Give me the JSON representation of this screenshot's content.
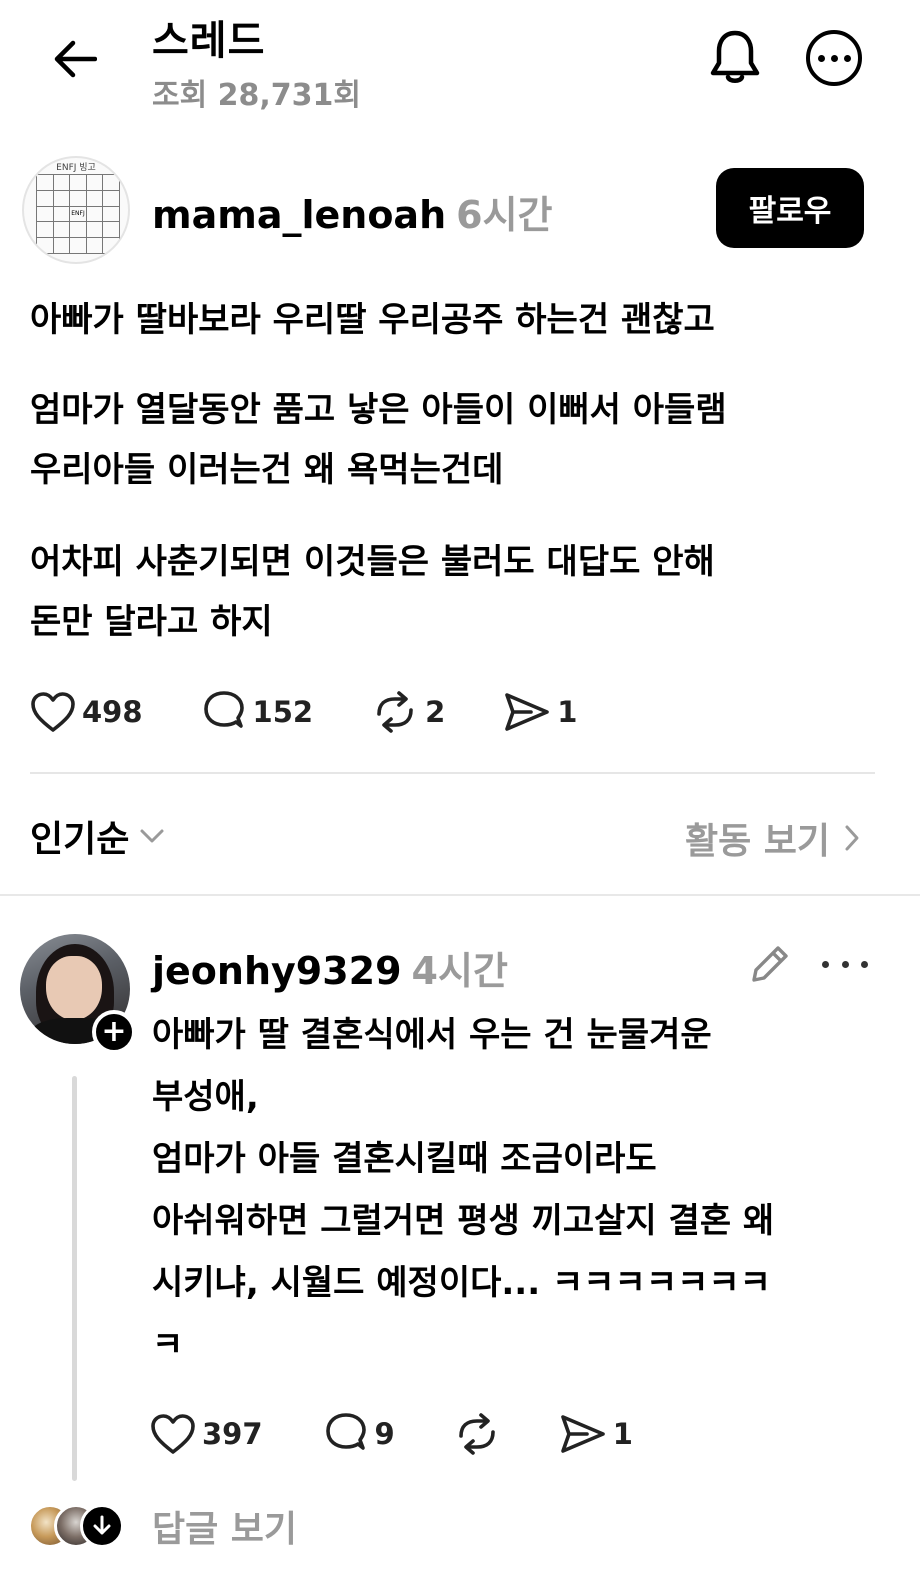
{
  "header": {
    "title": "스레드",
    "views": "조회 28,731회"
  },
  "post": {
    "author": "mama_lenoah",
    "time": "6시간",
    "follow_label": "팔로우",
    "avatar_caption": "ENFJ 빙고",
    "avatar_center": "ENFJ",
    "paragraphs": [
      [
        "아빠가 딸바보라 우리딸 우리공주 하는건 괜찮고"
      ],
      [
        "엄마가 열달동안 품고 낳은 아들이 이뻐서 아들램",
        "우리아들 이러는건 왜 욕먹는건데"
      ],
      [
        "어차피 사춘기되면 이것들은 불러도 대답도 안해",
        "돈만 달라고 하지"
      ]
    ],
    "stats": {
      "likes": "498",
      "comments": "152",
      "reposts": "2",
      "shares": "1"
    }
  },
  "sort": {
    "label": "인기순",
    "activity_label": "활동 보기"
  },
  "comment": {
    "author": "jeonhy9329",
    "time": "4시간",
    "text": "아빠가 딸 결혼식에서 우는 건 눈물겨운\n부성애,\n엄마가 아들 결혼시킬때 조금이라도\n아쉬워하면 그럴거면 평생 끼고살지 결혼 왜\n시키냐, 시월드 예정이다... ㅋㅋㅋㅋㅋㅋㅋ\nㅋ",
    "stats": {
      "likes": "397",
      "comments": "9",
      "shares": "1"
    },
    "view_replies_label": "답글 보기"
  },
  "icons": {
    "back": "arrow-left-icon",
    "notifications": "bell-icon",
    "more": "more-icon",
    "like": "heart-icon",
    "comment": "comment-icon",
    "repost": "repost-icon",
    "share": "send-icon",
    "edit": "pencil-icon",
    "sort": "chevron-down-icon",
    "activity": "chevron-right-icon",
    "add": "plus-icon",
    "expand": "arrow-down-icon"
  },
  "colors": {
    "text": "#000000",
    "muted": "#9a9a9a",
    "divider": "#e6e6e6",
    "button_bg": "#000000"
  }
}
